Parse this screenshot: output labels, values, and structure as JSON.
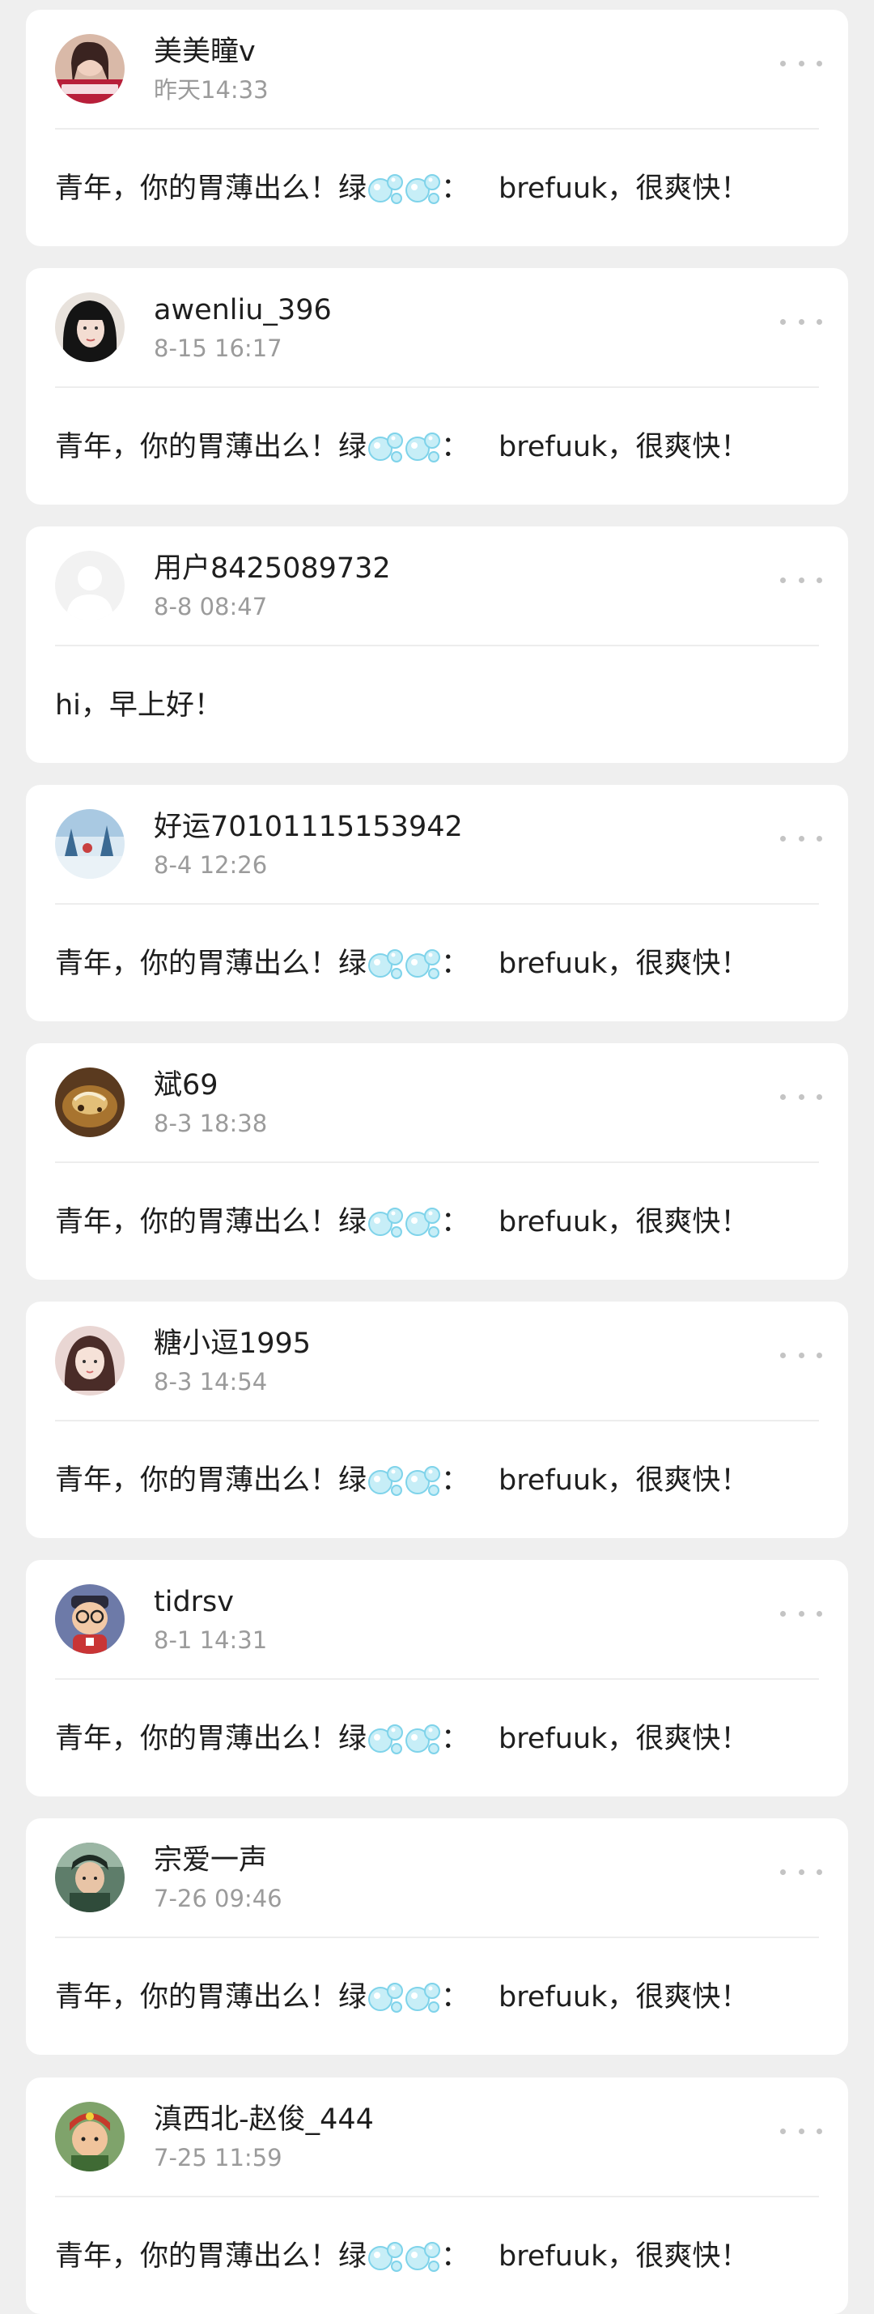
{
  "comments": [
    {
      "username": "美美瞳v",
      "time": "昨天14:33",
      "avatar": "avatar-portrait-icon",
      "text_before": "青年，你的胃薄出么！绿",
      "text_colon": "：",
      "text_after": "brefuuk，很爽快！",
      "emoji": "bubbles-icon"
    },
    {
      "username": "awenliu_396",
      "time": "8-15 16:17",
      "avatar": "avatar-portrait-icon",
      "text_before": "青年，你的胃薄出么！绿",
      "text_colon": "：",
      "text_after": "brefuuk，很爽快！",
      "emoji": "bubbles-icon"
    },
    {
      "username": "用户8425089732",
      "time": "8-8 08:47",
      "avatar": "default-avatar-icon",
      "text_plain": "hi，早上好！"
    },
    {
      "username": "好运70101115153942",
      "time": "8-4 12:26",
      "avatar": "avatar-scenery-icon",
      "text_before": "青年，你的胃薄出么！绿",
      "text_colon": "：",
      "text_after": "brefuuk，很爽快！",
      "emoji": "bubbles-icon"
    },
    {
      "username": "斌69",
      "time": "8-3 18:38",
      "avatar": "avatar-food-icon",
      "text_before": "青年，你的胃薄出么！绿",
      "text_colon": "：",
      "text_after": "brefuuk，很爽快！",
      "emoji": "bubbles-icon"
    },
    {
      "username": "糖小逗1995",
      "time": "8-3 14:54",
      "avatar": "avatar-portrait-icon",
      "text_before": "青年，你的胃薄出么！绿",
      "text_colon": "：",
      "text_after": "brefuuk，很爽快！",
      "emoji": "bubbles-icon"
    },
    {
      "username": "tidrsv",
      "time": "8-1 14:31",
      "avatar": "avatar-cartoon-icon",
      "text_before": "青年，你的胃薄出么！绿",
      "text_colon": "：",
      "text_after": "brefuuk，很爽快！",
      "emoji": "bubbles-icon"
    },
    {
      "username": "宗爱一声",
      "time": "7-26 09:46",
      "avatar": "avatar-portrait-icon",
      "text_before": "青年，你的胃薄出么！绿",
      "text_colon": "：",
      "text_after": "brefuuk，很爽快！",
      "emoji": "bubbles-icon"
    },
    {
      "username": "滇西北-赵俊_444",
      "time": "7-25 11:59",
      "avatar": "avatar-cartoon-icon",
      "text_before": "青年，你的胃薄出么！绿",
      "text_colon": "：",
      "text_after": "brefuuk，很爽快！",
      "emoji": "bubbles-icon"
    }
  ],
  "colors": {
    "background": "#efefef",
    "card": "#ffffff",
    "username": "#1e1e1e",
    "timestamp": "#9b9b9b",
    "bubble": "#7fd3ea"
  }
}
